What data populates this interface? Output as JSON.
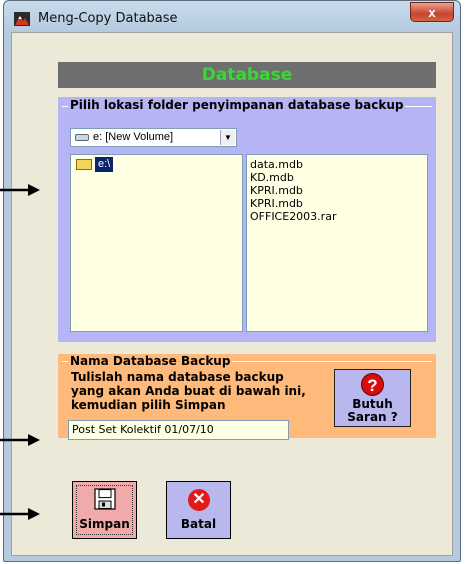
{
  "window": {
    "title": "Meng-Copy Database",
    "close_glyph": "x"
  },
  "header": {
    "title": "Database",
    "title_color": "#39d639"
  },
  "folder_group": {
    "label": "Pilih lokasi folder penyimpanan database backup",
    "drive_select": {
      "value": "e: [New Volume]",
      "icon": "drive-icon"
    },
    "directories": [
      {
        "label": "e:\\",
        "icon": "open-folder-icon",
        "selected": true
      }
    ],
    "files": [
      "data.mdb",
      "KD.mdb",
      "KPRI.mdb",
      "KPRI.mdb",
      "OFFICE2003.rar"
    ]
  },
  "name_group": {
    "label": "Nama Database Backup",
    "instruction_lines": [
      "Tulislah nama database backup",
      "yang akan Anda buat di bawah ini,",
      "kemudian pilih Simpan"
    ],
    "input_value": "Post Set Kolektif 01/07/10",
    "help_button": {
      "glyph": "?",
      "line1": "Butuh",
      "line2": "Saran ?"
    }
  },
  "actions": {
    "save_label": "Simpan",
    "cancel_label": "Batal",
    "cancel_glyph": "✕"
  },
  "colors": {
    "folder_panel": "#b5b5f5",
    "name_panel": "#ffb97a",
    "save_button": "#f0aaaa",
    "cancel_button": "#b8b8ee"
  }
}
